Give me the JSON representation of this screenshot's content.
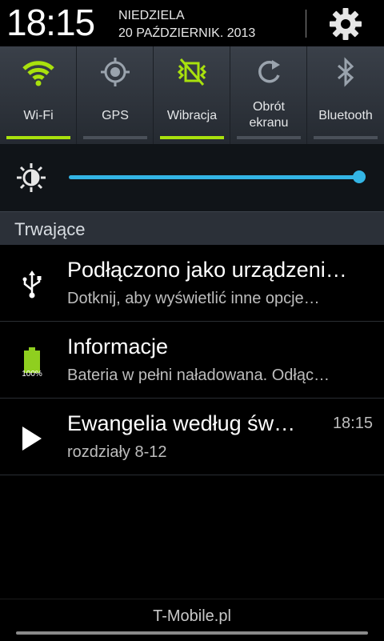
{
  "status": {
    "time": "18:15",
    "day": "NIEDZIELA",
    "date": "20 PAŹDZIERNIK. 2013"
  },
  "toggles": [
    {
      "label": "Wi-Fi",
      "icon": "wifi-icon",
      "active": true
    },
    {
      "label": "GPS",
      "icon": "gps-icon",
      "active": false
    },
    {
      "label": "Wibracja",
      "icon": "vibration-icon",
      "active": true
    },
    {
      "label": "Obrót ekranu",
      "icon": "rotate-icon",
      "active": false
    },
    {
      "label": "Bluetooth",
      "icon": "bluetooth-icon",
      "active": false
    }
  ],
  "brightness": {
    "level": 1.0,
    "icon": "brightness-icon"
  },
  "section": {
    "title": "Trwające"
  },
  "notifications": [
    {
      "title": "Podłączono jako urządzeni…",
      "text": "Dotknij, aby wyświetlić inne opcje…",
      "icon": "usb-icon"
    },
    {
      "title": "Informacje",
      "text": "Bateria w pełni naładowana. Odłąc…",
      "icon": "battery-full-icon",
      "badge": "100%"
    },
    {
      "title": "Ewangelia według św…",
      "text": "rozdziały 8-12",
      "time": "18:15",
      "icon": "play-icon"
    }
  ],
  "footer": {
    "carrier": "T-Mobile.pl"
  },
  "colors": {
    "accent_green": "#a9e10d",
    "accent_blue": "#33b5e5",
    "panel": "#2a2f36"
  }
}
